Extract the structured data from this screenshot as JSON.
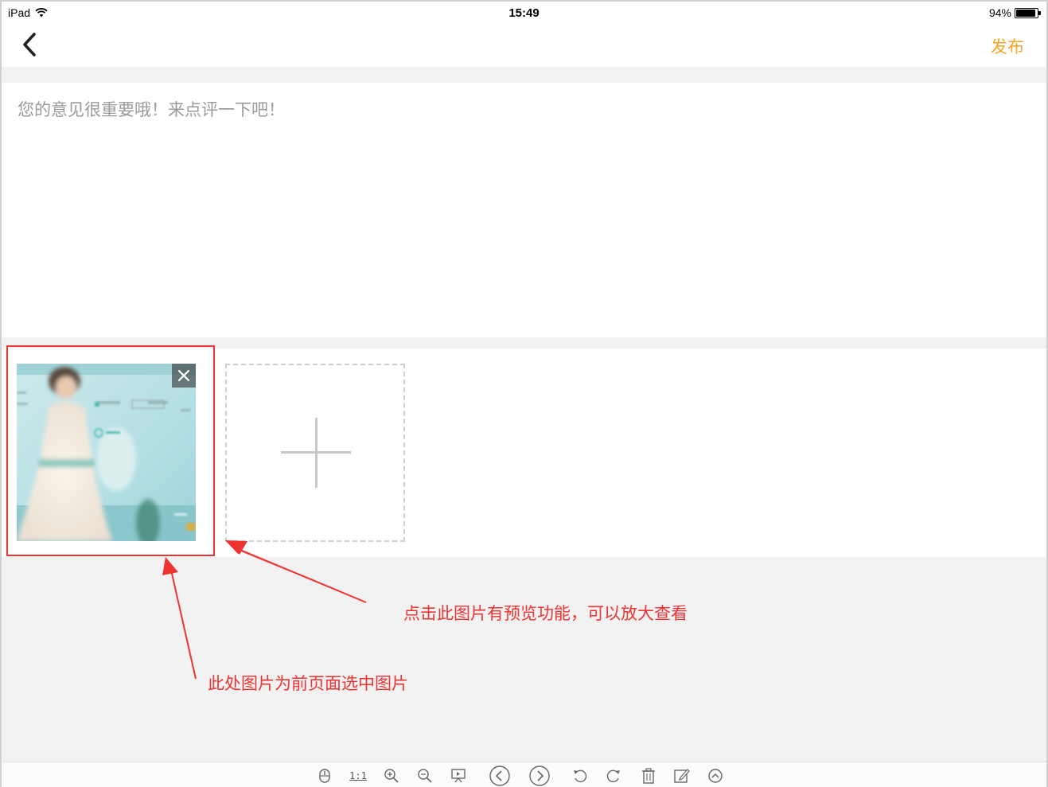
{
  "status_bar": {
    "device": "iPad",
    "time": "15:49",
    "battery_text": "94%",
    "battery_level": 0.94
  },
  "nav": {
    "publish_label": "发布",
    "back_icon": "chevron-left-icon",
    "accent_color": "#f5a623"
  },
  "comment": {
    "placeholder": "您的意见很重要哦！来点评一下吧！"
  },
  "photos": {
    "thumbnail_close_icon": "close-icon",
    "add_icon": "plus-icon"
  },
  "annotations": {
    "preview_note": "点击此图片有预览功能，可以放大查看",
    "selected_note": "此处图片为前页面选中图片",
    "color": "#ee3333"
  },
  "viewer_toolbar": {
    "actual_size_label": "1:1",
    "icons": [
      "mouse-icon",
      "actual-size-icon",
      "zoom-in-icon",
      "zoom-out-icon",
      "slideshow-icon",
      "previous-icon",
      "next-icon",
      "rotate-left-icon",
      "rotate-right-icon",
      "delete-icon",
      "edit-icon",
      "collapse-icon"
    ]
  }
}
